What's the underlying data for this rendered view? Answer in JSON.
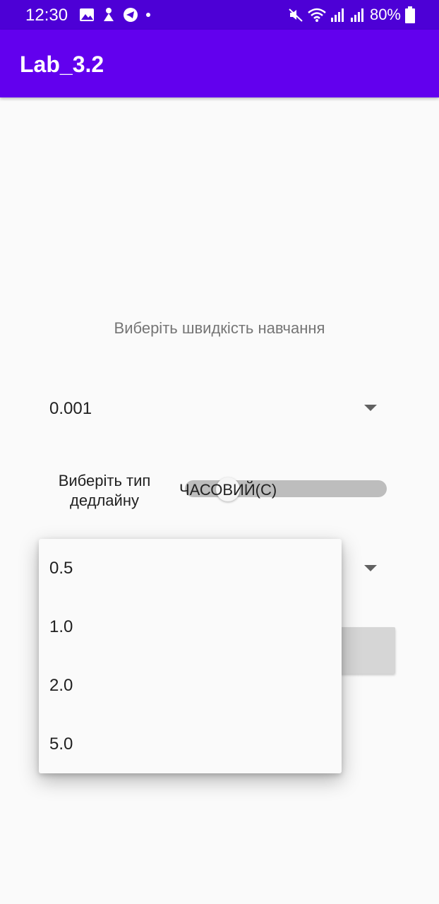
{
  "status_bar": {
    "time": "12:30",
    "battery": "80%",
    "icons": [
      "gallery-icon",
      "figure-icon",
      "telegram-icon",
      "dot-icon",
      "mute-icon",
      "wifi-icon",
      "signal-icon",
      "signal-icon",
      "battery-icon"
    ]
  },
  "app_bar": {
    "title": "Lab_3.2"
  },
  "main": {
    "prompt": "Виберіть швидкість навчання",
    "learning_rate_spinner": {
      "selected": "0.001"
    },
    "deadline": {
      "label_line1": "Виберіть тип",
      "label_line2": "дедлайну",
      "switch_text": "ЧАСОВИЙ(С)"
    }
  },
  "dropdown": {
    "items": [
      "0.5",
      "1.0",
      "2.0",
      "5.0"
    ]
  },
  "colors": {
    "status_bar": "#4d00d6",
    "app_bar": "#6200ee",
    "background": "#fafafa"
  }
}
